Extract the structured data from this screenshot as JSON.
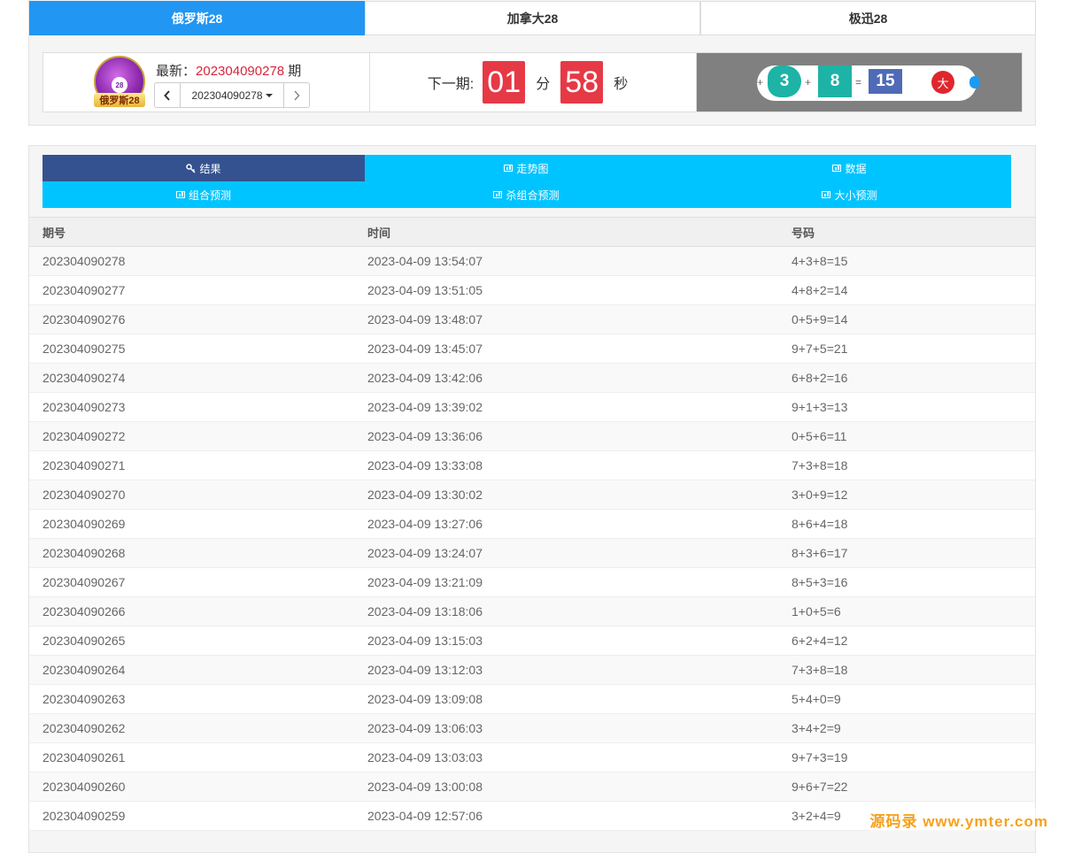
{
  "game_tabs": [
    {
      "label": "俄罗斯28",
      "active": true
    },
    {
      "label": "加拿大28",
      "active": false
    },
    {
      "label": "极迅28",
      "active": false
    }
  ],
  "logo": {
    "ball_text": "28",
    "text": "俄罗斯28"
  },
  "latest": {
    "label": "最新：",
    "number": "202304090278",
    "suffix": "期"
  },
  "period_select": {
    "value": "202304090278",
    "prev_icon": "chevron-left-icon",
    "next_icon": "chevron-right-icon"
  },
  "countdown": {
    "label": "下一期:",
    "minutes": "01",
    "min_unit": "分",
    "seconds": "58",
    "sec_unit": "秒"
  },
  "result": {
    "plus1": "+",
    "ball1": "3",
    "plus2": "+",
    "ball2": "8",
    "equals": "=",
    "sum": "15",
    "tag": "大"
  },
  "nav": [
    {
      "label": "结果",
      "icon": "key-icon",
      "active": true
    },
    {
      "label": "走势图",
      "icon": "chart-icon",
      "active": false
    },
    {
      "label": "数据",
      "icon": "chart-icon",
      "active": false
    },
    {
      "label": "组合预测",
      "icon": "chart-icon",
      "active": false
    },
    {
      "label": "杀组合预测",
      "icon": "chart-icon",
      "active": false
    },
    {
      "label": "大小预测",
      "icon": "chart-icon",
      "active": false
    }
  ],
  "table": {
    "headers": [
      "期号",
      "时间",
      "号码"
    ],
    "rows": [
      [
        "202304090278",
        "2023-04-09 13:54:07",
        "4+3+8=15"
      ],
      [
        "202304090277",
        "2023-04-09 13:51:05",
        "4+8+2=14"
      ],
      [
        "202304090276",
        "2023-04-09 13:48:07",
        "0+5+9=14"
      ],
      [
        "202304090275",
        "2023-04-09 13:45:07",
        "9+7+5=21"
      ],
      [
        "202304090274",
        "2023-04-09 13:42:06",
        "6+8+2=16"
      ],
      [
        "202304090273",
        "2023-04-09 13:39:02",
        "9+1+3=13"
      ],
      [
        "202304090272",
        "2023-04-09 13:36:06",
        "0+5+6=11"
      ],
      [
        "202304090271",
        "2023-04-09 13:33:08",
        "7+3+8=18"
      ],
      [
        "202304090270",
        "2023-04-09 13:30:02",
        "3+0+9=12"
      ],
      [
        "202304090269",
        "2023-04-09 13:27:06",
        "8+6+4=18"
      ],
      [
        "202304090268",
        "2023-04-09 13:24:07",
        "8+3+6=17"
      ],
      [
        "202304090267",
        "2023-04-09 13:21:09",
        "8+5+3=16"
      ],
      [
        "202304090266",
        "2023-04-09 13:18:06",
        "1+0+5=6"
      ],
      [
        "202304090265",
        "2023-04-09 13:15:03",
        "6+2+4=12"
      ],
      [
        "202304090264",
        "2023-04-09 13:12:03",
        "7+3+8=18"
      ],
      [
        "202304090263",
        "2023-04-09 13:09:08",
        "5+4+0=9"
      ],
      [
        "202304090262",
        "2023-04-09 13:06:03",
        "3+4+2=9"
      ],
      [
        "202304090261",
        "2023-04-09 13:03:03",
        "9+7+3=19"
      ],
      [
        "202304090260",
        "2023-04-09 13:00:08",
        "9+6+7=22"
      ],
      [
        "202304090259",
        "2023-04-09 12:57:06",
        "3+2+4=9"
      ]
    ]
  },
  "watermark": "源码录 www.ymter.com",
  "colors": {
    "accent": "#2196f3",
    "nav": "#00c4ff",
    "nav_active": "#34528f",
    "countdown": "#e63946",
    "ball": "#1db3a6",
    "sum": "#4f6bb7",
    "tag": "#e0262d"
  }
}
